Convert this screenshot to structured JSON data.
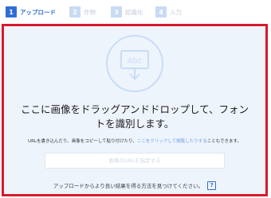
{
  "steps": [
    {
      "number": "1",
      "label": "アップロード",
      "state": "active"
    },
    {
      "number": "2",
      "label": "作物",
      "state": "inactive"
    },
    {
      "number": "3",
      "label": "認識化",
      "state": "inactive"
    },
    {
      "number": "4",
      "label": "入力",
      "state": "inactive"
    }
  ],
  "dropzone": {
    "icon": "abc-image-download-icon",
    "icon_text": "Abc",
    "headline_line1": "ここに画像をドラッグアンドドロップして、フォン",
    "headline_line2": "トを識別します。",
    "desc_before_link": "URLを書き込んだり、画像をコピーして貼り付けたり、",
    "desc_link": "ここをクリックして閲覧したりする",
    "desc_after_link": "こともできます。",
    "url_button_label": "画像のURLを指定する",
    "hint_text": "アップロードからより良い結果を得る方法を見つけてください。",
    "help_label": "?"
  },
  "colors": {
    "accent": "#2f6fd6",
    "border_highlight": "#d7192b",
    "dropzone_bg": "#eef4fc",
    "step_inactive": "#c9daf3"
  }
}
